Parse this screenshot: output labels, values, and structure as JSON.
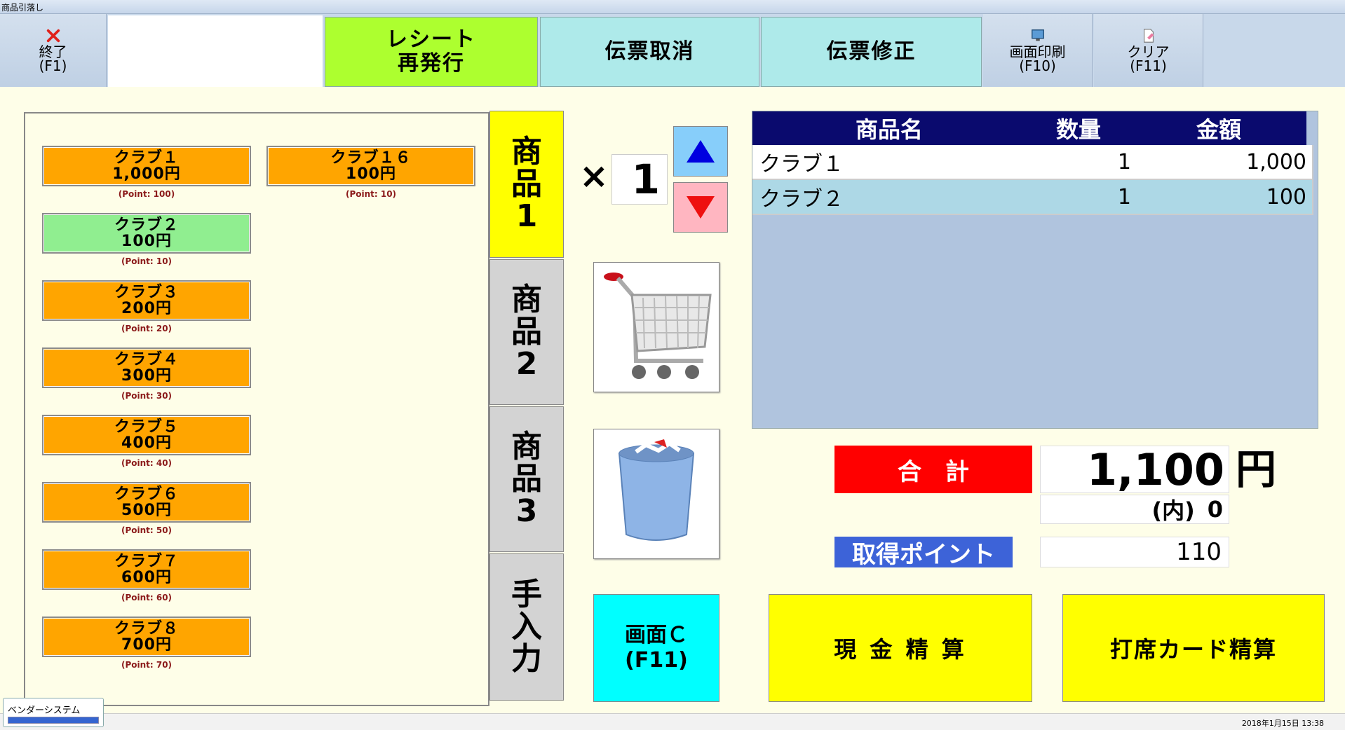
{
  "window": {
    "title": "商品引落し"
  },
  "toolbar": {
    "exit": {
      "label": "終了",
      "key": "(F1)"
    },
    "receipt": {
      "line1": "レシート",
      "line2": "再発行"
    },
    "cancel_slip": "伝票取消",
    "fix_slip": "伝票修正",
    "print_screen": {
      "label": "画面印刷",
      "key": "(F10)"
    },
    "clear": {
      "label": "クリア",
      "key": "(F11)"
    }
  },
  "products": [
    {
      "name": "クラブ１",
      "price": "1,000円",
      "point": "(Point: 100)",
      "color": "#ffa500"
    },
    {
      "name": "クラブ１６",
      "price": "100円",
      "point": "(Point: 10)",
      "color": "#ffa500"
    },
    {
      "name": "クラブ２",
      "price": "100円",
      "point": "(Point: 10)",
      "color": "#90ee90"
    },
    {
      "name": "クラブ３",
      "price": "200円",
      "point": "(Point: 20)",
      "color": "#ffa500"
    },
    {
      "name": "クラブ４",
      "price": "300円",
      "point": "(Point: 30)",
      "color": "#ffa500"
    },
    {
      "name": "クラブ５",
      "price": "400円",
      "point": "(Point: 40)",
      "color": "#ffa500"
    },
    {
      "name": "クラブ６",
      "price": "500円",
      "point": "(Point: 50)",
      "color": "#ffa500"
    },
    {
      "name": "クラブ７",
      "price": "600円",
      "point": "(Point: 60)",
      "color": "#ffa500"
    },
    {
      "name": "クラブ８",
      "price": "700円",
      "point": "(Point: 70)",
      "color": "#ffa500"
    }
  ],
  "category_tabs": [
    {
      "label": "商品１",
      "lines": [
        "商",
        "品",
        "1"
      ],
      "active": true
    },
    {
      "label": "商品２",
      "lines": [
        "商",
        "品",
        "2"
      ],
      "active": false
    },
    {
      "label": "商品３",
      "lines": [
        "商",
        "品",
        "3"
      ],
      "active": false
    },
    {
      "label": "手入力",
      "lines": [
        "手",
        "入",
        "力"
      ],
      "active": false
    }
  ],
  "quantity": {
    "times": "×",
    "value": "1"
  },
  "screen_c": {
    "line1": "画面Ｃ",
    "line2": "(F11)"
  },
  "cart": {
    "headers": [
      "商品名",
      "数量",
      "金額"
    ],
    "rows": [
      {
        "name": "クラブ１",
        "qty": "1",
        "amount": "1,000",
        "selected": false
      },
      {
        "name": "クラブ２",
        "qty": "1",
        "amount": "100",
        "selected": true
      }
    ]
  },
  "totals": {
    "total_label": "合　計",
    "total_value": "1,100",
    "currency": "円",
    "tax_label": "(内)",
    "tax_value": "0",
    "points_label": "取得ポイント",
    "points_value": "110"
  },
  "pay": {
    "cash": "現 金 精 算",
    "card": "打席カード精算"
  },
  "status": {
    "app": "ベンダーシステム",
    "datetime": "2018年1月15日 13:38"
  },
  "colors": {
    "total_label_bg": "#ff0000",
    "points_label_bg": "#3d63d8",
    "cart_header_bg": "#0a0a6e",
    "active_tab": "#ffff00",
    "screen_c_bg": "#00ffff"
  }
}
